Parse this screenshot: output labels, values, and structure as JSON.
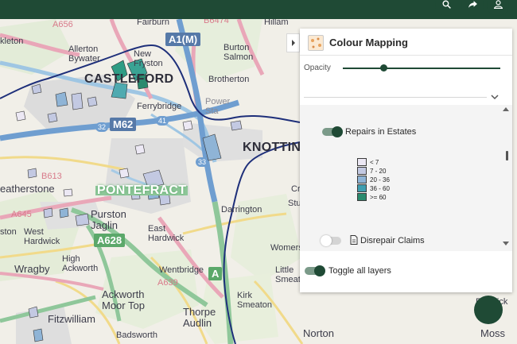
{
  "toolbar": {
    "icons": [
      "search-icon",
      "share-icon",
      "account-icon"
    ]
  },
  "map": {
    "places": {
      "hillam": "Hillam",
      "fairburn": "Fairburn",
      "burton_salmon": "Burton\nSalmon",
      "allerton_bywater": "Allerton\nBywater",
      "new_fryston": "New\nFryston",
      "brotherton": "Brotherton",
      "power_station": "Power\nSta",
      "ferrybridge": "Ferrybridge",
      "knottingley": "KNOTTING",
      "castleford": "CASTLEFORD",
      "pontefract": "PONTEFRACT",
      "featherstone": "eatherstone",
      "purston_jaglin": "Purston\nJaglin",
      "west_hardwick": "West\nHardwick",
      "east_hardwick": "East\nHardwick",
      "darrington": "Darrington",
      "high_ackworth": "High\nAckworth",
      "wragby": "Wragby",
      "wentbridge": "Wentbridge",
      "ackworth_moor_top": "Ackworth\nMoor Top",
      "thorpe_audlin": "Thorpe\nAudlin",
      "fitzwilliam": "Fitzwilliam",
      "badsworth": "Badsworth",
      "kirk_smeaton": "Kirk\nSmeaton",
      "little_smeaton": "Little\nSmeaton",
      "norton": "Norton",
      "moss": "Moss",
      "fenwick": "Fenwick",
      "womersley": "Womers",
      "cridling": "Cri",
      "stubbs": "Stub",
      "kleton": "kleton",
      "ston": "ston"
    },
    "road_labels": {
      "a1m": "A1(M)",
      "m62": "M62",
      "a628": "A628",
      "a645": "A645",
      "a639": "A639",
      "a656": "A656",
      "b6136": "B613",
      "b6474": "B6474",
      "junction_32": "32",
      "junction_33": "33",
      "junction_41": "41",
      "a1_short": "A"
    }
  },
  "panel": {
    "title": "Colour Mapping",
    "opacity_label": "Opacity",
    "opacity_value": 0.26,
    "layers": [
      {
        "label": "Repairs in Estates",
        "enabled": true
      },
      {
        "label": "Disrepair Claims",
        "enabled": false
      }
    ],
    "legend": [
      {
        "label": "< 7",
        "color": "#ece8f4"
      },
      {
        "label": "7 - 20",
        "color": "#c3c9e2"
      },
      {
        "label": "20 - 36",
        "color": "#8fb4d6"
      },
      {
        "label": "36 - 60",
        "color": "#3f9eb0"
      },
      {
        "label": ">= 60",
        "color": "#2a8a6e"
      }
    ],
    "toggle_all_label": "Toggle all layers",
    "toggle_all_enabled": true
  }
}
